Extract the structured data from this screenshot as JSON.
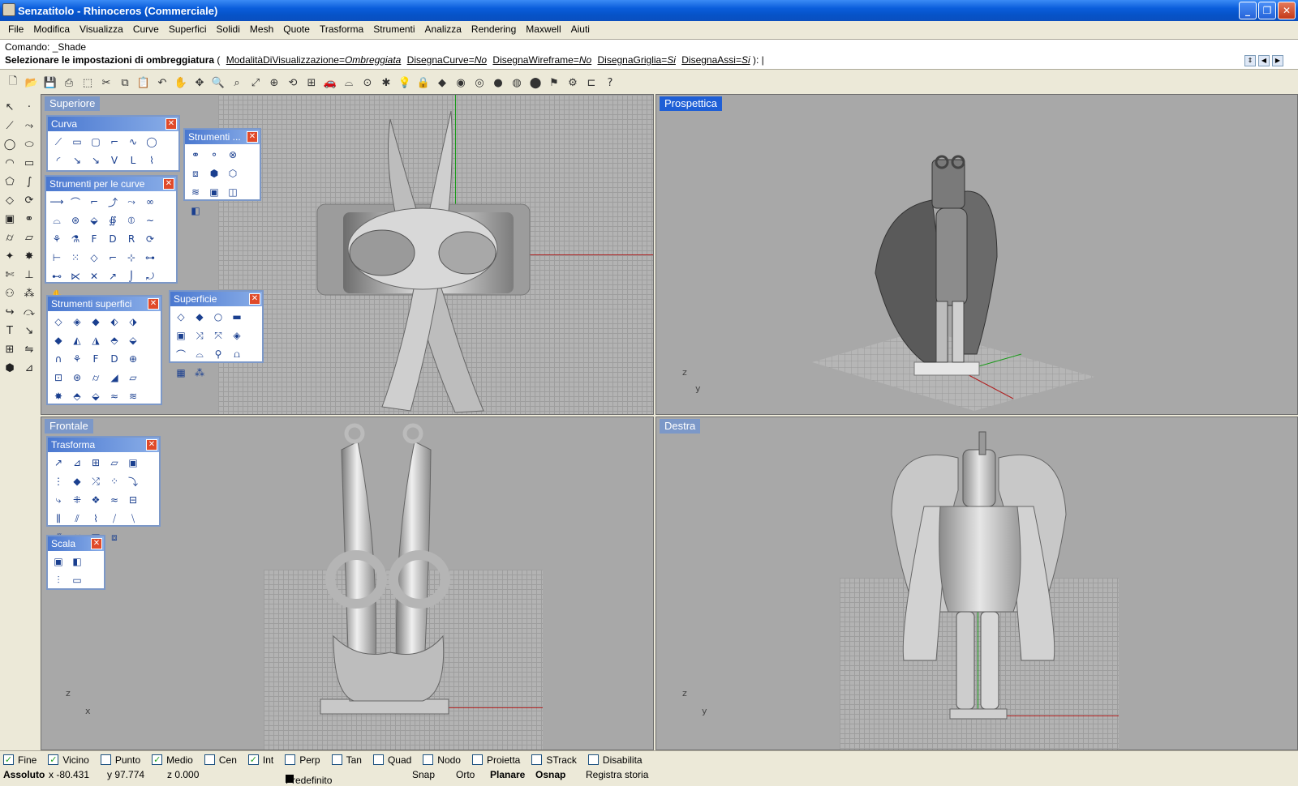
{
  "window": {
    "title": "Senzatitolo - Rhinoceros (Commerciale)",
    "controls": [
      "minimize",
      "restore",
      "close"
    ]
  },
  "menu": [
    "File",
    "Modifica",
    "Visualizza",
    "Curve",
    "Superfici",
    "Solidi",
    "Mesh",
    "Quote",
    "Trasforma",
    "Strumenti",
    "Analizza",
    "Rendering",
    "Maxwell",
    "Aiuti"
  ],
  "command": {
    "history": "Comando: _Shade",
    "prompt": "Selezionare le impostazioni di ombreggiatura",
    "open_paren": "(",
    "options": [
      {
        "name": "ModalitàDiVisualizzazione",
        "value": "Ombreggiata"
      },
      {
        "name": "DisegnaCurve",
        "value": "No"
      },
      {
        "name": "DisegnaWireframe",
        "value": "No"
      },
      {
        "name": "DisegnaGriglia",
        "value": "Si"
      },
      {
        "name": "DisegnaAssi",
        "value": "Si"
      }
    ],
    "close": "):"
  },
  "viewports": {
    "top": {
      "label": "Superiore"
    },
    "perspective": {
      "label": "Prospettica"
    },
    "front": {
      "label": "Frontale"
    },
    "right": {
      "label": "Destra"
    }
  },
  "axes": {
    "z": "z",
    "x": "x",
    "y": "y"
  },
  "palettes": {
    "curva": {
      "title": "Curva"
    },
    "strumenti_solidi": {
      "title": "Strumenti ..."
    },
    "strumenti_curve": {
      "title": "Strumenti per le curve"
    },
    "strumenti_superfici": {
      "title": "Strumenti superfici"
    },
    "superficie": {
      "title": "Superficie"
    },
    "trasforma": {
      "title": "Trasforma"
    },
    "scala": {
      "title": "Scala"
    }
  },
  "osnaps": [
    {
      "label": "Fine",
      "checked": true
    },
    {
      "label": "Vicino",
      "checked": true
    },
    {
      "label": "Punto",
      "checked": false
    },
    {
      "label": "Medio",
      "checked": true
    },
    {
      "label": "Cen",
      "checked": false
    },
    {
      "label": "Int",
      "checked": true
    },
    {
      "label": "Perp",
      "checked": false
    },
    {
      "label": "Tan",
      "checked": false
    },
    {
      "label": "Quad",
      "checked": false
    },
    {
      "label": "Nodo",
      "checked": false
    },
    {
      "label": "Proietta",
      "checked": false
    },
    {
      "label": "STrack",
      "checked": false
    },
    {
      "label": "Disabilita",
      "checked": false
    }
  ],
  "statusbar": {
    "mode": "Assoluto",
    "x": "x -80.431",
    "y": "y 97.774",
    "z": "z 0.000",
    "layer": "Predefinito",
    "snap": "Snap",
    "orto": "Orto",
    "planare": "Planare",
    "osnap": "Osnap",
    "history": "Registra storia"
  },
  "colors": {
    "viewport_bg": "#a8a8a8",
    "active_label": "#1f5fd6",
    "inactive_label": "#7c98c8",
    "x_axis": "#b02020",
    "y_axis": "#1a9a1a"
  }
}
